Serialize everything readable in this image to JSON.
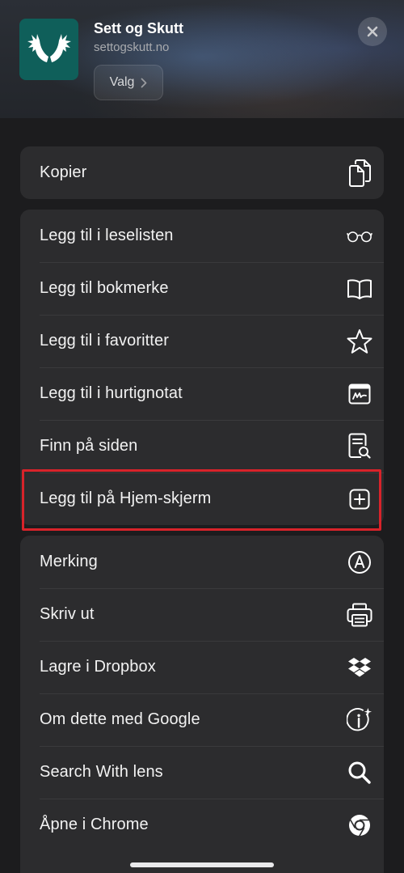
{
  "header": {
    "app_title": "Sett og Skutt",
    "app_url": "settogskutt.no",
    "options_label": "Valg",
    "brand_color": "#0f5f5a"
  },
  "groups": [
    {
      "items": [
        {
          "label": "Kopier",
          "icon": "copy-icon"
        }
      ]
    },
    {
      "items": [
        {
          "label": "Legg til i leselisten",
          "icon": "glasses-icon"
        },
        {
          "label": "Legg til bokmerke",
          "icon": "book-icon"
        },
        {
          "label": "Legg til i favoritter",
          "icon": "star-icon"
        },
        {
          "label": "Legg til i hurtignotat",
          "icon": "quick-note-icon"
        },
        {
          "label": "Finn på siden",
          "icon": "find-on-page-icon"
        },
        {
          "label": "Legg til på Hjem-skjerm",
          "icon": "add-square-icon"
        }
      ]
    },
    {
      "items": [
        {
          "label": "Merking",
          "icon": "markup-icon"
        },
        {
          "label": "Skriv ut",
          "icon": "printer-icon"
        },
        {
          "label": "Lagre i Dropbox",
          "icon": "dropbox-icon"
        },
        {
          "label": "Om dette med Google",
          "icon": "info-sparkle-icon"
        },
        {
          "label": "Search With lens",
          "icon": "search-icon"
        },
        {
          "label": "Åpne i Chrome",
          "icon": "chrome-icon"
        }
      ]
    }
  ],
  "highlight_color": "#d8232a"
}
